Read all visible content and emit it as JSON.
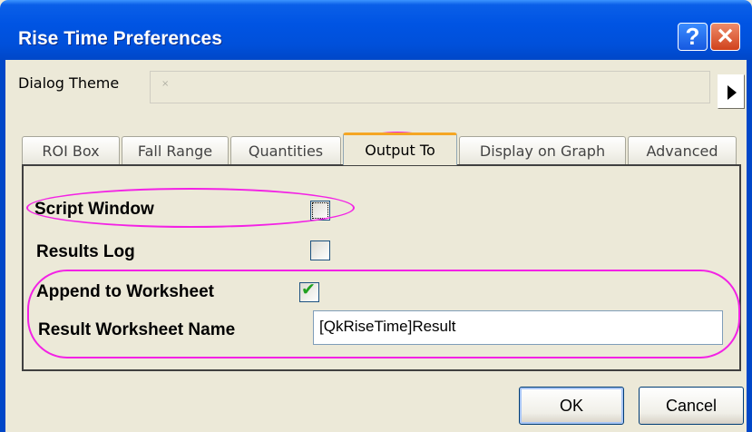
{
  "window": {
    "title": "Rise Time Preferences",
    "help_label": "?",
    "close_label": "✕"
  },
  "theme": {
    "label": "Dialog Theme",
    "value": "×"
  },
  "tabs": [
    {
      "label": "ROI Box"
    },
    {
      "label": "Fall Range"
    },
    {
      "label": "Quantities"
    },
    {
      "label": "Output To",
      "active": true
    },
    {
      "label": "Display on Graph"
    },
    {
      "label": "Advanced"
    }
  ],
  "output_to": {
    "script_window": {
      "label": "Script Window",
      "checked": false
    },
    "results_log": {
      "label": "Results Log",
      "checked": false
    },
    "append_to_worksheet": {
      "label": "Append to Worksheet",
      "checked": true,
      "checkmark": "✔"
    },
    "result_worksheet_name": {
      "label": "Result Worksheet Name",
      "value": "[QkRiseTime]Result"
    }
  },
  "buttons": {
    "ok": "OK",
    "cancel": "Cancel"
  },
  "colors": {
    "titlebar": "#0054E3",
    "dialog_bg": "#ECE9D8",
    "annotation": "#F321E5",
    "active_tab_accent": "#F5A623",
    "checkmark": "#21A121"
  },
  "icons": [
    "help-icon",
    "close-icon",
    "play-arrow-icon",
    "checkmark-icon"
  ]
}
